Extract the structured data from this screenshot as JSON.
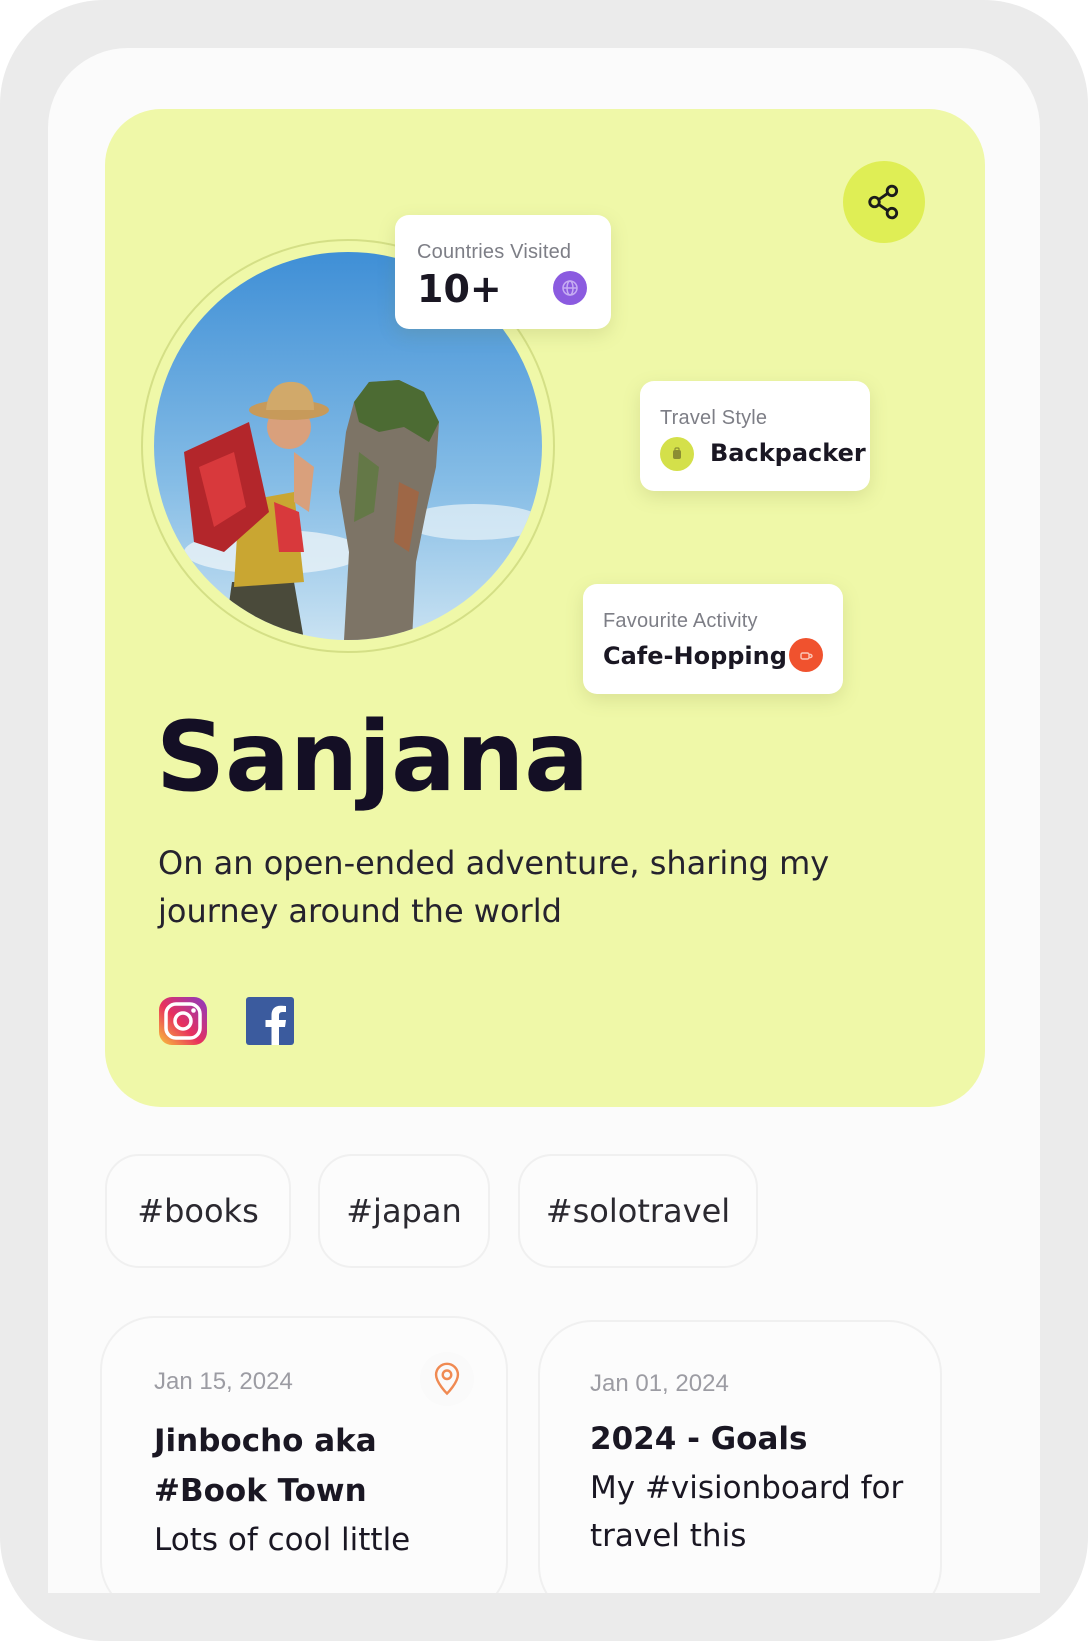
{
  "profile": {
    "name": "Sanjana",
    "bio": "On an open-ended adventure, sharing my journey around the world"
  },
  "stats": {
    "countries": {
      "label": "Countries Visited",
      "value": "10+",
      "icon": "globe-icon",
      "color": "#8b5be0"
    },
    "style": {
      "label": "Travel Style",
      "value": "Backpacker",
      "icon": "backpack-icon",
      "color": "#d4e04a"
    },
    "activity": {
      "label": "Favourite Activity",
      "value": "Cafe-Hopping",
      "icon": "coffee-icon",
      "color": "#f0522e"
    }
  },
  "social": [
    {
      "name": "instagram-icon"
    },
    {
      "name": "facebook-icon"
    }
  ],
  "tags": [
    "#books",
    "#japan",
    "#solotravel"
  ],
  "posts": [
    {
      "date": "Jan 15, 2024",
      "title": "Jinbocho aka #Book Town",
      "excerpt": "Lots of cool little",
      "icon": "location-pin-icon"
    },
    {
      "date": "Jan 01, 2024",
      "title": "2024 - Goals",
      "excerpt": "My #visionboard for travel this"
    }
  ],
  "colors": {
    "card": "#eff8a8",
    "share_button": "#dfee55",
    "text_dark": "#140f25",
    "pin": "#f08a52"
  }
}
